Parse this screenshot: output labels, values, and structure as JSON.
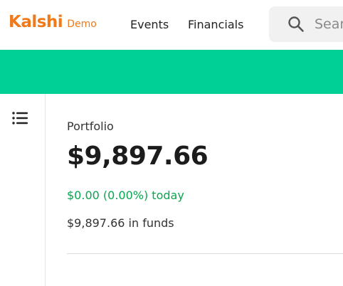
{
  "header": {
    "logo_text": "Kalshi",
    "demo_label": "Demo",
    "nav": [
      {
        "label": "Events"
      },
      {
        "label": "Financials"
      }
    ],
    "search": {
      "placeholder": "Search",
      "icon": "search-icon"
    }
  },
  "colors": {
    "brand": "#f07a1a",
    "banner": "#00d096",
    "positive": "#08a650"
  },
  "sidebar": {
    "menu_icon": "list-icon"
  },
  "portfolio": {
    "label": "Portfolio",
    "value": "$9,897.66",
    "change_text": "$0.00 (0.00%) today",
    "funds_text": "$9,897.66 in funds"
  }
}
